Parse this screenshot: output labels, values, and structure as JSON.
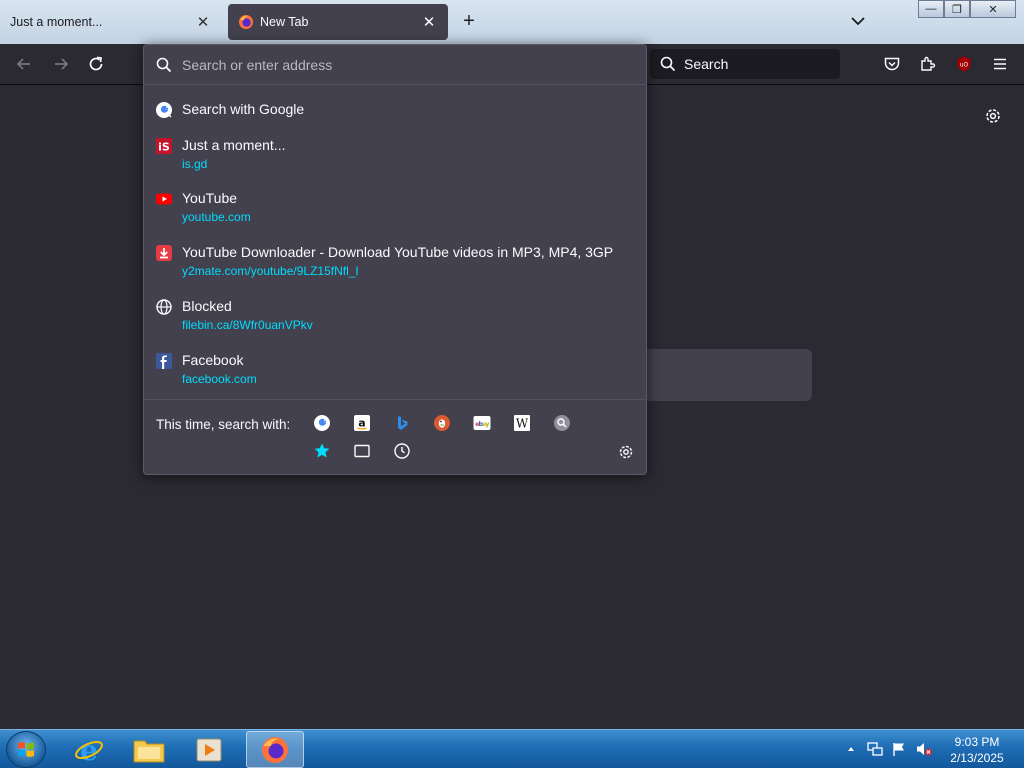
{
  "tabs": [
    {
      "label": "Just a moment...",
      "active": false
    },
    {
      "label": "New Tab",
      "active": true
    }
  ],
  "navbar": {
    "search_label": "Search"
  },
  "urlbar": {
    "placeholder": "Search or enter address",
    "results": [
      {
        "title": "Search with Google",
        "url": "",
        "icon": "google-g-icon"
      },
      {
        "title": "Just a moment...",
        "url": "is.gd",
        "icon": "isgd-favicon"
      },
      {
        "title": "YouTube",
        "url": "youtube.com",
        "icon": "youtube-icon"
      },
      {
        "title": "YouTube Downloader - Download YouTube videos in MP3, MP4, 3GP",
        "url": "y2mate.com/youtube/9LZ15fNfl_I",
        "icon": "download-icon"
      },
      {
        "title": "Blocked",
        "url": "filebin.ca/8Wfr0uanVPkv",
        "icon": "globe-icon"
      },
      {
        "title": "Facebook",
        "url": "facebook.com",
        "icon": "facebook-icon"
      }
    ],
    "oneoff_label": "This time, search with:",
    "engines": [
      "google",
      "amazon",
      "bing",
      "duckduckgo",
      "ebay",
      "wikipedia",
      "search-engine",
      "bookmarks",
      "tabs",
      "history"
    ]
  },
  "taskbar": {
    "time": "9:03 PM",
    "date": "2/13/2025"
  },
  "colors": {
    "accent": "#00ddff",
    "toolbar": "#2b2a33",
    "panel": "#42414d"
  }
}
